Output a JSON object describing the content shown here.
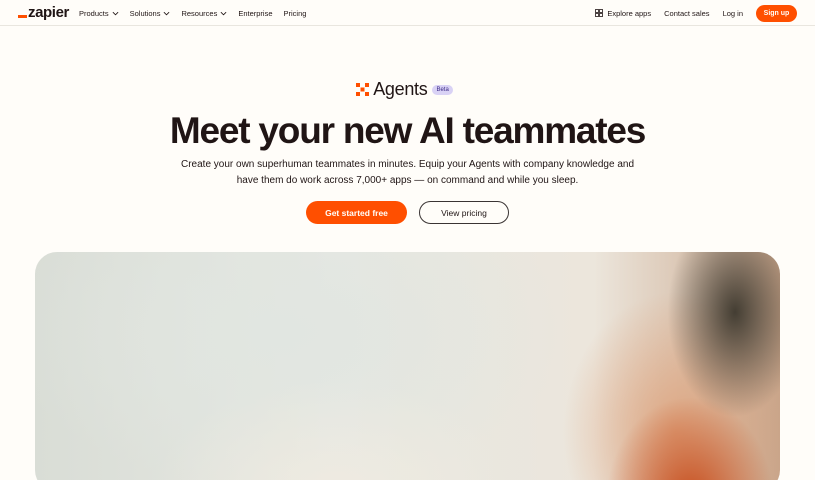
{
  "nav": {
    "logo": "zapier",
    "left_items": [
      {
        "label": "Products",
        "has_dropdown": true
      },
      {
        "label": "Solutions",
        "has_dropdown": true
      },
      {
        "label": "Resources",
        "has_dropdown": true
      },
      {
        "label": "Enterprise",
        "has_dropdown": false
      },
      {
        "label": "Pricing",
        "has_dropdown": false
      }
    ],
    "explore_apps": "Explore apps",
    "contact_sales": "Contact sales",
    "login": "Log in",
    "signup": "Sign up"
  },
  "hero": {
    "product_name": "Agents",
    "badge": "Beta",
    "headline": "Meet your new AI teammates",
    "subtext_line1": "Create your own superhuman teammates in minutes. Equip your Agents with company knowledge and",
    "subtext_line2": "have them do work across 7,000+ apps — on command and while you sleep.",
    "primary_cta": "Get started free",
    "secondary_cta": "View pricing"
  },
  "colors": {
    "brand_orange": "#ff4f00",
    "background": "#fffdf9",
    "text": "#201515",
    "beta_badge": "#d9d2f5"
  }
}
